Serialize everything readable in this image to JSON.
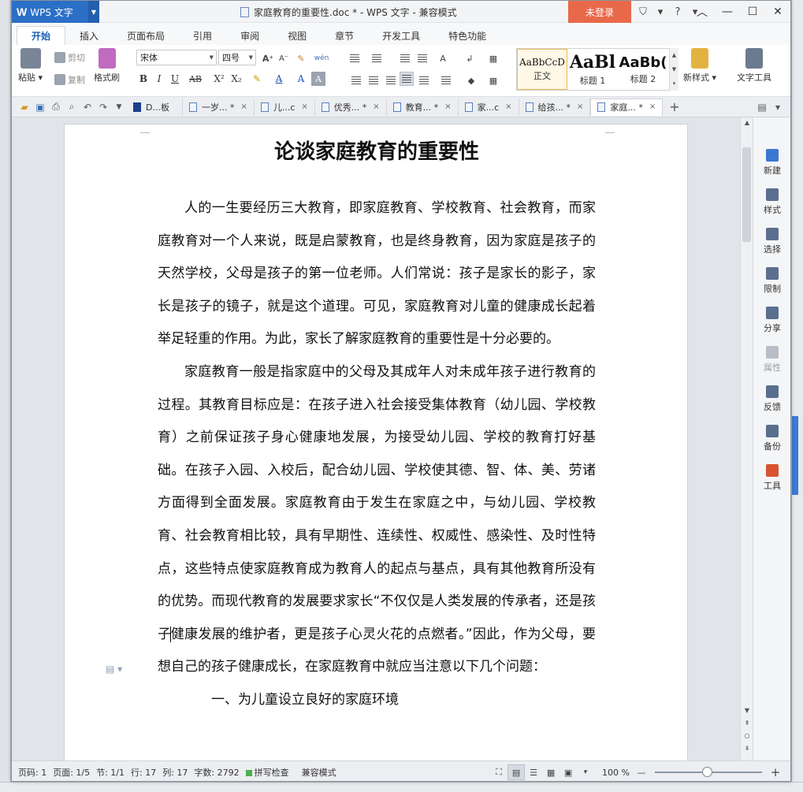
{
  "window": {
    "app_name": "WPS 文字",
    "title": "家庭教育的重要性.doc * - WPS 文字 - 兼容模式",
    "login_label": "未登录"
  },
  "ribbon_tabs": [
    "开始",
    "插入",
    "页面布局",
    "引用",
    "审阅",
    "视图",
    "章节",
    "开发工具",
    "特色功能"
  ],
  "ribbon": {
    "paste_label": "粘贴",
    "cut_label": "剪切",
    "copy_label": "复制",
    "format_painter_label": "格式刷",
    "font_name": "宋体",
    "font_size": "四号",
    "styles": [
      {
        "sample": "AaBbCcD",
        "name": "正文"
      },
      {
        "sample": "AaBl",
        "name": "标题 1"
      },
      {
        "sample": "AaBb(",
        "name": "标题 2"
      }
    ],
    "new_style_label": "新样式",
    "text_tools_label": "文字工具"
  },
  "doc_tabs": [
    {
      "label": "D...板",
      "close": ""
    },
    {
      "label": "一岁... *",
      "close": "×"
    },
    {
      "label": "儿...c",
      "close": "×"
    },
    {
      "label": "优秀... *",
      "close": "×"
    },
    {
      "label": "教育... *",
      "close": "×"
    },
    {
      "label": "家...c",
      "close": "×"
    },
    {
      "label": "给孩... *",
      "close": "×"
    },
    {
      "label": "家庭... *",
      "close": "×"
    }
  ],
  "document": {
    "title": "论谈家庭教育的重要性",
    "p1": "人的一生要经历三大教育，即家庭教育、学校教育、社会教育，而家庭教育对一个人来说，既是启蒙教育，也是终身教育，因为家庭是孩子的天然学校，父母是孩子的第一位老师。人们常说：孩子是家长的影子，家长是孩子的镜子，就是这个道理。可见，家庭教育对儿童的健康成长起着举足轻重的作用。为此，家长了解家庭教育的重要性是十分必要的。",
    "p2_a": "家庭教育一般是指家庭中的父母及其成年人对未成年孩子进行教育的过程。其教育目标应是：在孩子进入社会接受集体教育（幼儿园、学校教育）之前保证孩子身心健康地发展，为接受幼儿园、学校的教育打好基础。在孩子入园、入校后，配合幼儿园、学校使其德、智、体、美、劳诸方面得到全面发展。家庭教育由于发生在家庭之中，与幼儿园、学校教育、社会教育相比较，具有早期性、连续性、权威性、感染性、及时性特点，这些特点使家庭教育成为教育人的起点与基点，具有其他教育所没有的优势。而现代教育的发展要求家长“不仅仅是人类发展的传承者，还是孩子",
    "p2_b": "健康发展的维护者，更是孩子心灵火花的点燃者。”因此，作为父母，要想自己的孩子健康成长，在家庭教育中就应当注意以下几个问题：",
    "p3": "一、为儿童设立良好的家庭环境"
  },
  "side_panel": [
    "新建",
    "样式",
    "选择",
    "限制",
    "分享",
    "属性",
    "反馈",
    "备份",
    "工具"
  ],
  "status": {
    "page_num": "页码: 1",
    "pages": "页面: 1/5",
    "section": "节: 1/1",
    "row": "行: 17",
    "col": "列: 17",
    "word_count": "字数: 2792",
    "spell_check": "拼写检查",
    "compat_mode": "兼容模式",
    "zoom": "100 %"
  },
  "colors": {
    "app_blue": "#2b6fc7",
    "login_orange": "#e8694a",
    "active_tab_text": "#1b5fb3"
  }
}
